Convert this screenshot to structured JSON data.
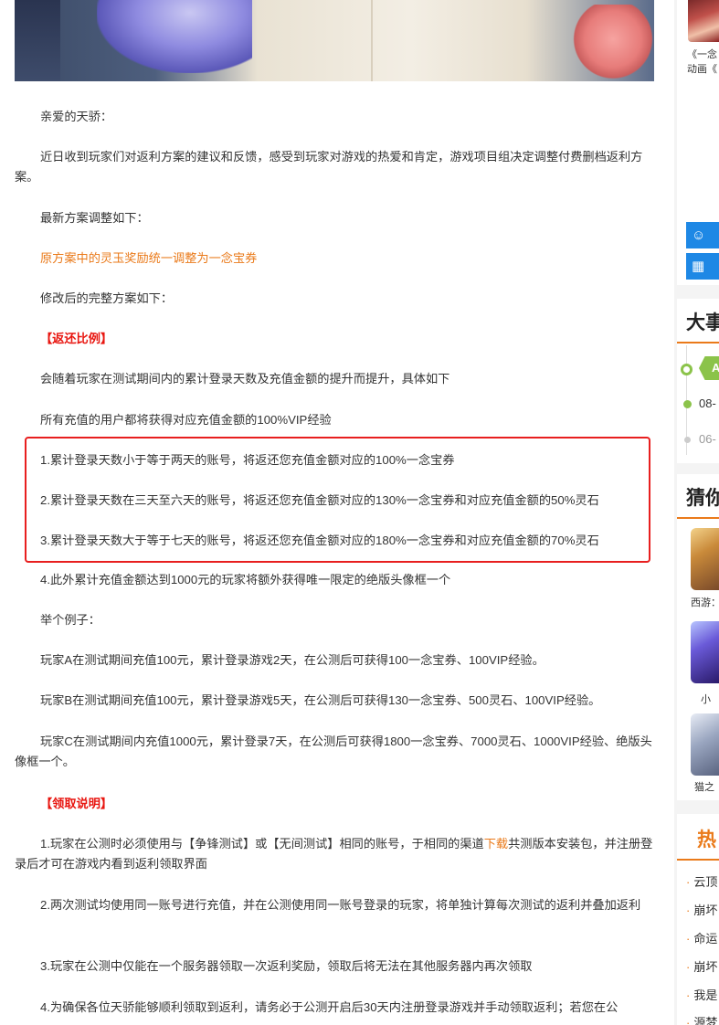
{
  "article": {
    "greeting": "亲爱的天骄：",
    "intro": "近日收到玩家们对返利方案的建议和反馈，感受到玩家对游戏的热爱和肯定，游戏项目组决定调整付费删档返利方案。",
    "adjust_heading": "最新方案调整如下：",
    "adjust_item": "原方案中的灵玉奖励统一调整为一念宝券",
    "full_plan_heading": "修改后的完整方案如下：",
    "section1_title": "【返还比例】",
    "section1_desc": "会随着玩家在测试期间内的累计登录天数及充值金额的提升而提升，具体如下",
    "vip_note": "所有充值的用户都将获得对应充值金额的100%VIP经验",
    "rule1": "1.累计登录天数小于等于两天的账号，将返还您充值金额对应的100%一念宝券",
    "rule2": "2.累计登录天数在三天至六天的账号，将返还您充值金额对应的130%一念宝券和对应充值金额的50%灵石",
    "rule3": "3.累计登录天数大于等于七天的账号，将返还您充值金额对应的180%一念宝券和对应充值金额的70%灵石",
    "rule4": "4.此外累计充值金额达到1000元的玩家将额外获得唯一限定的绝版头像框一个",
    "example_heading": "举个例子：",
    "example_a": "玩家A在测试期间充值100元，累计登录游戏2天，在公测后可获得100一念宝券、100VIP经验。",
    "example_b": "玩家B在测试期间充值100元，累计登录游戏5天，在公测后可获得130一念宝券、500灵石、100VIP经验。",
    "example_c": "玩家C在测试期间内充值1000元，累计登录7天，在公测后可获得1800一念宝券、7000灵石、1000VIP经验、绝版头像框一个。",
    "section2_title": "【领取说明】",
    "claim1_before": "1.玩家在公测时必须使用与【争锋测试】或【无间测试】相同的账号，于相同的渠道",
    "claim1_link": "下载",
    "claim1_after": "共测版本安装包，并注册登录后才可在游戏内看到返利领取界面",
    "claim2": "2.两次测试均使用同一账号进行充值，并在公测使用同一账号登录的玩家，将单独计算每次测试的返利并叠加返利",
    "claim3": "3.玩家在公测中仅能在一个服务器领取一次返利奖励，领取后将无法在其他服务器内再次领取",
    "claim4": "4.为确保各位天骄能够顺利领取到返利，请务必于公测开启后30天内注册登录游戏并手动领取返利；若您在公"
  },
  "sidebar": {
    "top_card": {
      "line1": "《一念",
      "line2": "动画《"
    },
    "events_title": "大事",
    "events": [
      {
        "badge": "A"
      },
      {
        "date": "08-"
      },
      {
        "date": "06-"
      }
    ],
    "guess_title": "猜你",
    "guess_games": [
      {
        "name": "西游："
      },
      {
        "name": "小"
      },
      {
        "name": "猫之"
      }
    ],
    "hot_title": "热",
    "hot_items": [
      "云顶",
      "崩坏",
      "命运",
      "崩坏",
      "我是",
      "源梦"
    ]
  },
  "colors": {
    "accent": "#ea7a1a",
    "red": "#e8150f",
    "box": "#e81f1f",
    "blue": "#1e88e5",
    "green": "#8bc34a"
  },
  "icons": [
    "face-icon",
    "calendar-icon"
  ]
}
